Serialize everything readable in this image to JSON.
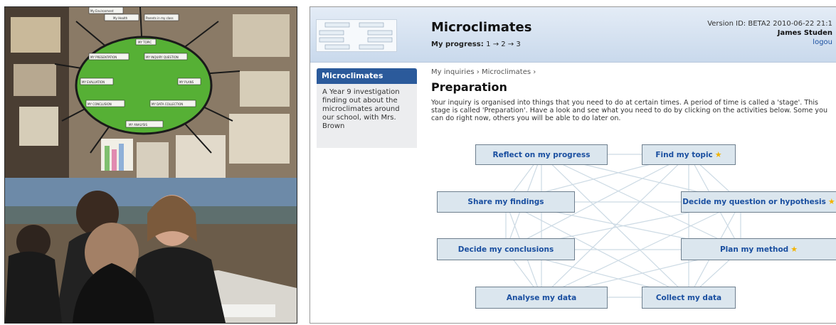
{
  "photo": {
    "board_labels": [
      "My Environment",
      "My Health",
      "Parents in my class",
      "MY TOPIC",
      "MY PRESENTATION",
      "MY INQUIRY QUESTION",
      "MY EVALUATION",
      "MY PLANS",
      "MY CONCLUSION",
      "MY DATA COLLECTION",
      "MY ANALYSIS"
    ]
  },
  "header": {
    "app_title": "Microclimates",
    "progress_label": "My progress:",
    "progress_value": "1 → 2 → 3",
    "version": "Version ID: BETA2 2010-06-22 21:1",
    "user": "James Studen",
    "logout": "logou"
  },
  "sidebar": {
    "title": "Microclimates",
    "description": "A Year 9 investigation finding out about the microclimates around our school, with Mrs. Brown"
  },
  "breadcrumb": {
    "root": "My inquiries",
    "sep1": "›",
    "current": "Microclimates",
    "sep2": "›"
  },
  "page": {
    "title": "Preparation",
    "intro": "Your inquiry is organised into things that you need to do at certain times. A period of time is called a 'stage'. This stage is called 'Preparation'. Have a look and see what you need to do by clicking on the activities below. Some you can do right now, others you will be able to do later on."
  },
  "activities": {
    "reflect": "Reflect on my progress",
    "find_topic": "Find my topic",
    "share": "Share my findings",
    "decide_question": "Decide my question or hypothesis",
    "conclusions": "Decide my conclusions",
    "plan_method": "Plan my method",
    "analyse": "Analyse my data",
    "collect": "Collect my data",
    "star_icon": "star-icon"
  },
  "colors": {
    "header_bg": "#d6e3f1",
    "sidebar_head": "#2b5a9b",
    "link": "#1a4fa0",
    "activity_bg": "#dbe6ee",
    "star": "#f2b300"
  }
}
